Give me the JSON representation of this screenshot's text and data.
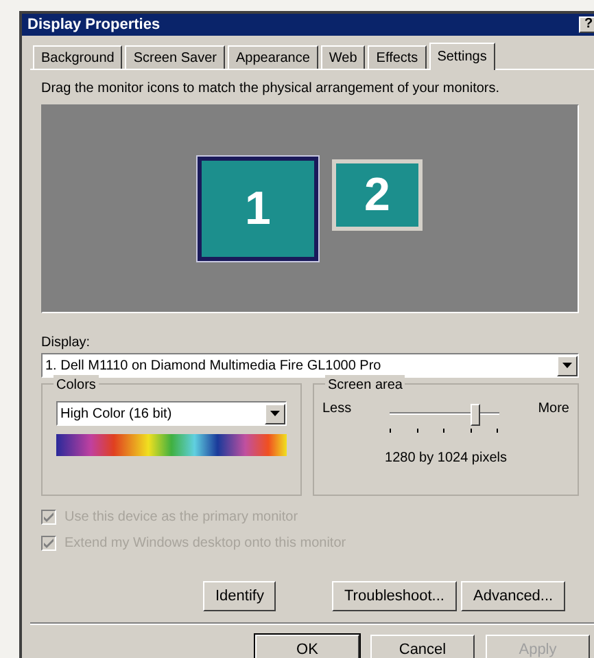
{
  "window": {
    "title": "Display Properties",
    "help_button": "?"
  },
  "tabs": [
    {
      "label": "Background",
      "selected": false
    },
    {
      "label": "Screen Saver",
      "selected": false
    },
    {
      "label": "Appearance",
      "selected": false
    },
    {
      "label": "Web",
      "selected": false
    },
    {
      "label": "Effects",
      "selected": false
    },
    {
      "label": "Settings",
      "selected": true
    }
  ],
  "instruction": "Drag the monitor icons to match the physical arrangement of your monitors.",
  "monitors": [
    {
      "label": "1",
      "selected": true
    },
    {
      "label": "2",
      "selected": false
    }
  ],
  "display": {
    "label": "Display:",
    "value": "1. Dell M1110 on Diamond Multimedia Fire GL1000 Pro"
  },
  "colors": {
    "title": "Colors",
    "value": "High Color (16 bit)"
  },
  "screen_area": {
    "title": "Screen area",
    "less": "Less",
    "more": "More",
    "level": 0.8,
    "reading": "1280 by 1024 pixels"
  },
  "options": [
    {
      "label": "Use this device as the primary monitor",
      "checked": true,
      "disabled": true
    },
    {
      "label": "Extend my Windows desktop onto this monitor",
      "checked": true,
      "disabled": true
    }
  ],
  "buttons": [
    {
      "label": "Identify",
      "disabled": false
    },
    {
      "label": "Troubleshoot...",
      "disabled": false
    },
    {
      "label": "Advanced...",
      "disabled": false
    }
  ],
  "dialog_buttons": [
    {
      "label": "OK",
      "disabled": false,
      "default": true
    },
    {
      "label": "Cancel",
      "disabled": false,
      "default": false
    },
    {
      "label": "Apply",
      "disabled": true,
      "default": false
    }
  ]
}
